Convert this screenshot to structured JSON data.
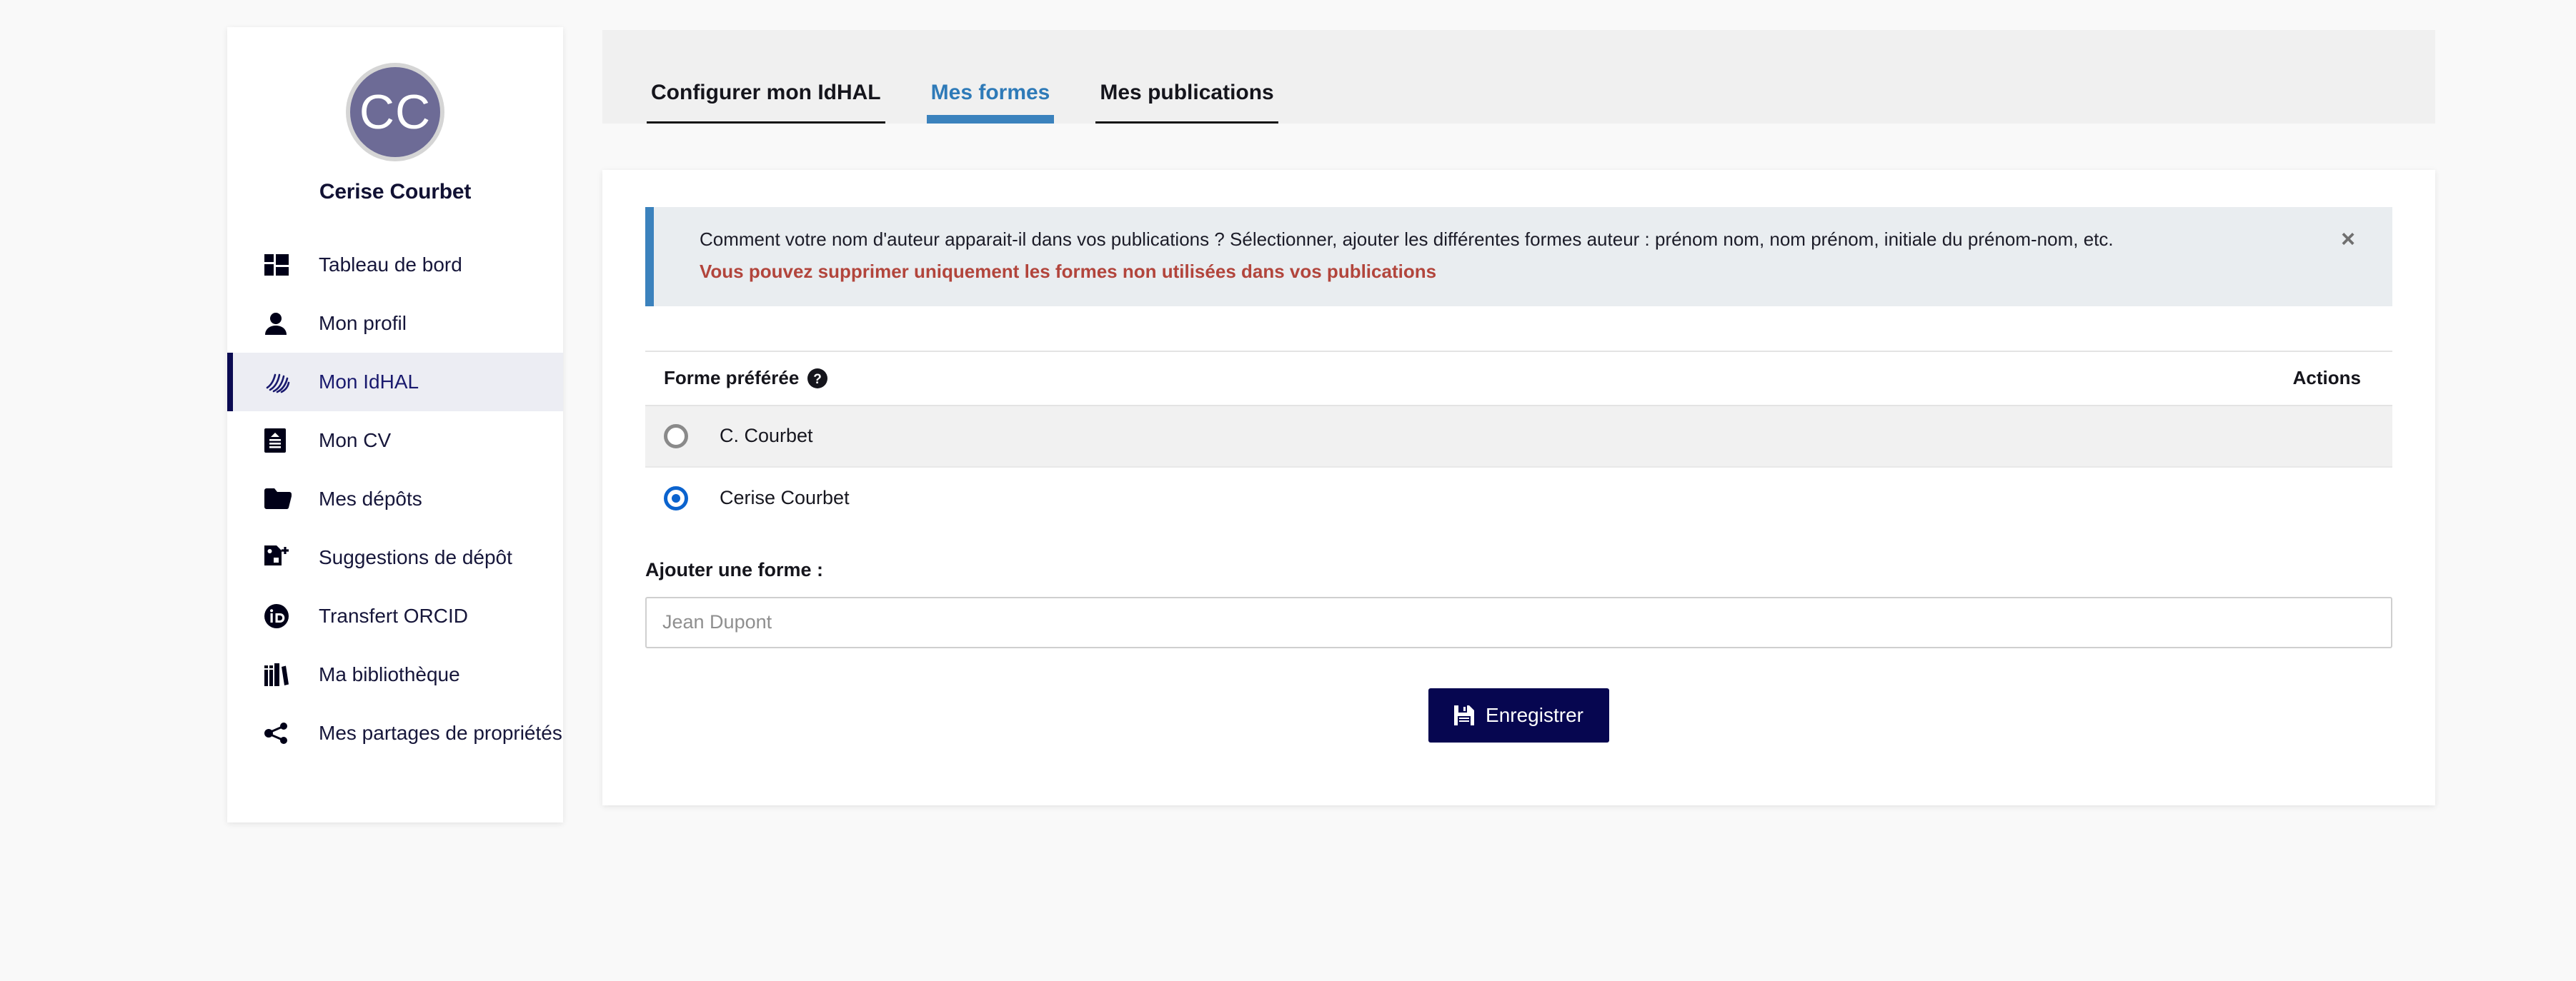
{
  "colors": {
    "accent_navy": "#060650",
    "accent_blue": "#3b82bd",
    "alert_bg": "#e9edf0",
    "alert_border": "#3b82bd",
    "warn_red": "#b2453c",
    "avatar_bg": "#6d6b96",
    "radio_checked": "#0b63ce",
    "page_bg": "#f9f9f9"
  },
  "sidebar": {
    "avatar_initials": "CC",
    "profile_name": "Cerise Courbet",
    "items": [
      {
        "label": "Tableau de bord",
        "icon": "dashboard-icon",
        "active": false
      },
      {
        "label": "Mon profil",
        "icon": "person-icon",
        "active": false
      },
      {
        "label": "Mon IdHAL",
        "icon": "hal-logo-icon",
        "active": true
      },
      {
        "label": "Mon CV",
        "icon": "cv-document-icon",
        "active": false
      },
      {
        "label": "Mes dépôts",
        "icon": "folder-icon",
        "active": false
      },
      {
        "label": "Suggestions de dépôt",
        "icon": "file-plus-icon",
        "active": false
      },
      {
        "label": "Transfert ORCID",
        "icon": "orcid-icon",
        "active": false
      },
      {
        "label": "Ma bibliothèque",
        "icon": "books-icon",
        "active": false
      },
      {
        "label": "Mes partages de propriétés",
        "icon": "share-icon",
        "active": false
      }
    ]
  },
  "tabs": [
    {
      "label": "Configurer mon IdHAL",
      "active": false
    },
    {
      "label": "Mes formes",
      "active": true
    },
    {
      "label": "Mes publications",
      "active": false
    }
  ],
  "alert": {
    "line1": "Comment votre nom d'auteur apparait-il dans vos publications ? Sélectionner, ajouter les différentes formes auteur : prénom nom, nom prénom, initiale du prénom-nom, etc.",
    "line2": "Vous pouvez supprimer uniquement les formes non utilisées dans vos publications",
    "close_label": "×"
  },
  "table": {
    "header_forme": "Forme préférée",
    "header_help_icon": "help-circle-icon",
    "header_actions": "Actions",
    "rows": [
      {
        "label": "C. Courbet",
        "selected": false
      },
      {
        "label": "Cerise Courbet",
        "selected": true
      }
    ]
  },
  "add_form": {
    "label": "Ajouter une forme :",
    "placeholder": "Jean Dupont",
    "value": ""
  },
  "save_button": {
    "label": "Enregistrer",
    "icon": "floppy-save-icon"
  }
}
